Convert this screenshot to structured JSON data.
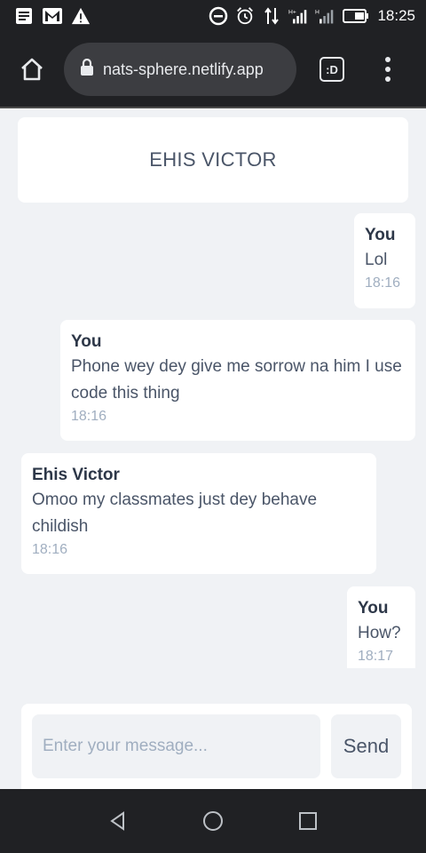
{
  "status_bar": {
    "time": "18:25",
    "icons": [
      "notes-icon",
      "gmail-icon",
      "warning-icon",
      "dnd-icon",
      "alarm-icon",
      "data-arrows-icon",
      "signal-h-icon",
      "signal-h2-icon",
      "battery-icon"
    ]
  },
  "browser": {
    "url": "nats-sphere.netlify.app",
    "tabs_label": ":D"
  },
  "chat": {
    "title": "EHIS VICTOR"
  },
  "messages": [
    {
      "sender": "You",
      "text": "Lol",
      "time": "18:16",
      "side": "right"
    },
    {
      "sender": "You",
      "text": "Phone wey dey give me sorrow na him I use code this thing",
      "time": "18:16",
      "side": "right"
    },
    {
      "sender": "Ehis Victor",
      "text": "Omoo my classmates just dey behave childish",
      "time": "18:16",
      "side": "left"
    },
    {
      "sender": "You",
      "text": "How?",
      "time": "18:17",
      "side": "right"
    }
  ],
  "composer": {
    "placeholder": "Enter your message...",
    "send_label": "Send"
  },
  "colors": {
    "page_bg": "#f0f2f5",
    "bubble_bg": "#ffffff",
    "text": "#4a5568",
    "muted": "#a0aec0",
    "chrome": "#202124"
  }
}
